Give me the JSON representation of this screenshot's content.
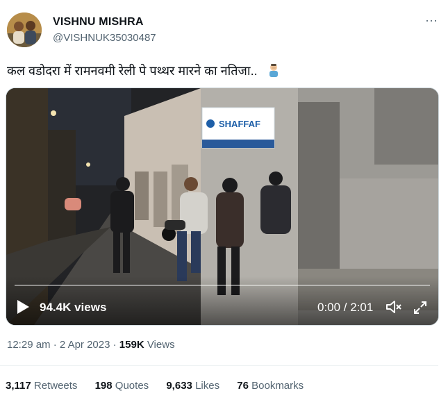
{
  "author": {
    "display_name": "VISHNU MISHRA",
    "handle": "@VISHNUK35030487"
  },
  "tweet": {
    "text": "कल वडोदरा में रामनवमी रेली पे पथ्थर मारने का नतिजा..",
    "emoji": "person-facepalming-emoji"
  },
  "video": {
    "views_label": "94.4K views",
    "time_label": "0:00 / 2:01",
    "progress_fraction": 0,
    "sign_text": "SHAFFAF"
  },
  "meta": {
    "time": "12:29 am",
    "separator": "·",
    "date": "2 Apr 2023",
    "views_count": "159K",
    "views_word": "Views"
  },
  "stats": [
    {
      "count": "3,117",
      "label": "Retweets"
    },
    {
      "count": "198",
      "label": "Quotes"
    },
    {
      "count": "9,633",
      "label": "Likes"
    },
    {
      "count": "76",
      "label": "Bookmarks"
    }
  ],
  "colors": {
    "secondary_text": "#536471",
    "primary_text": "#0f1419",
    "border": "#cfd9de"
  }
}
